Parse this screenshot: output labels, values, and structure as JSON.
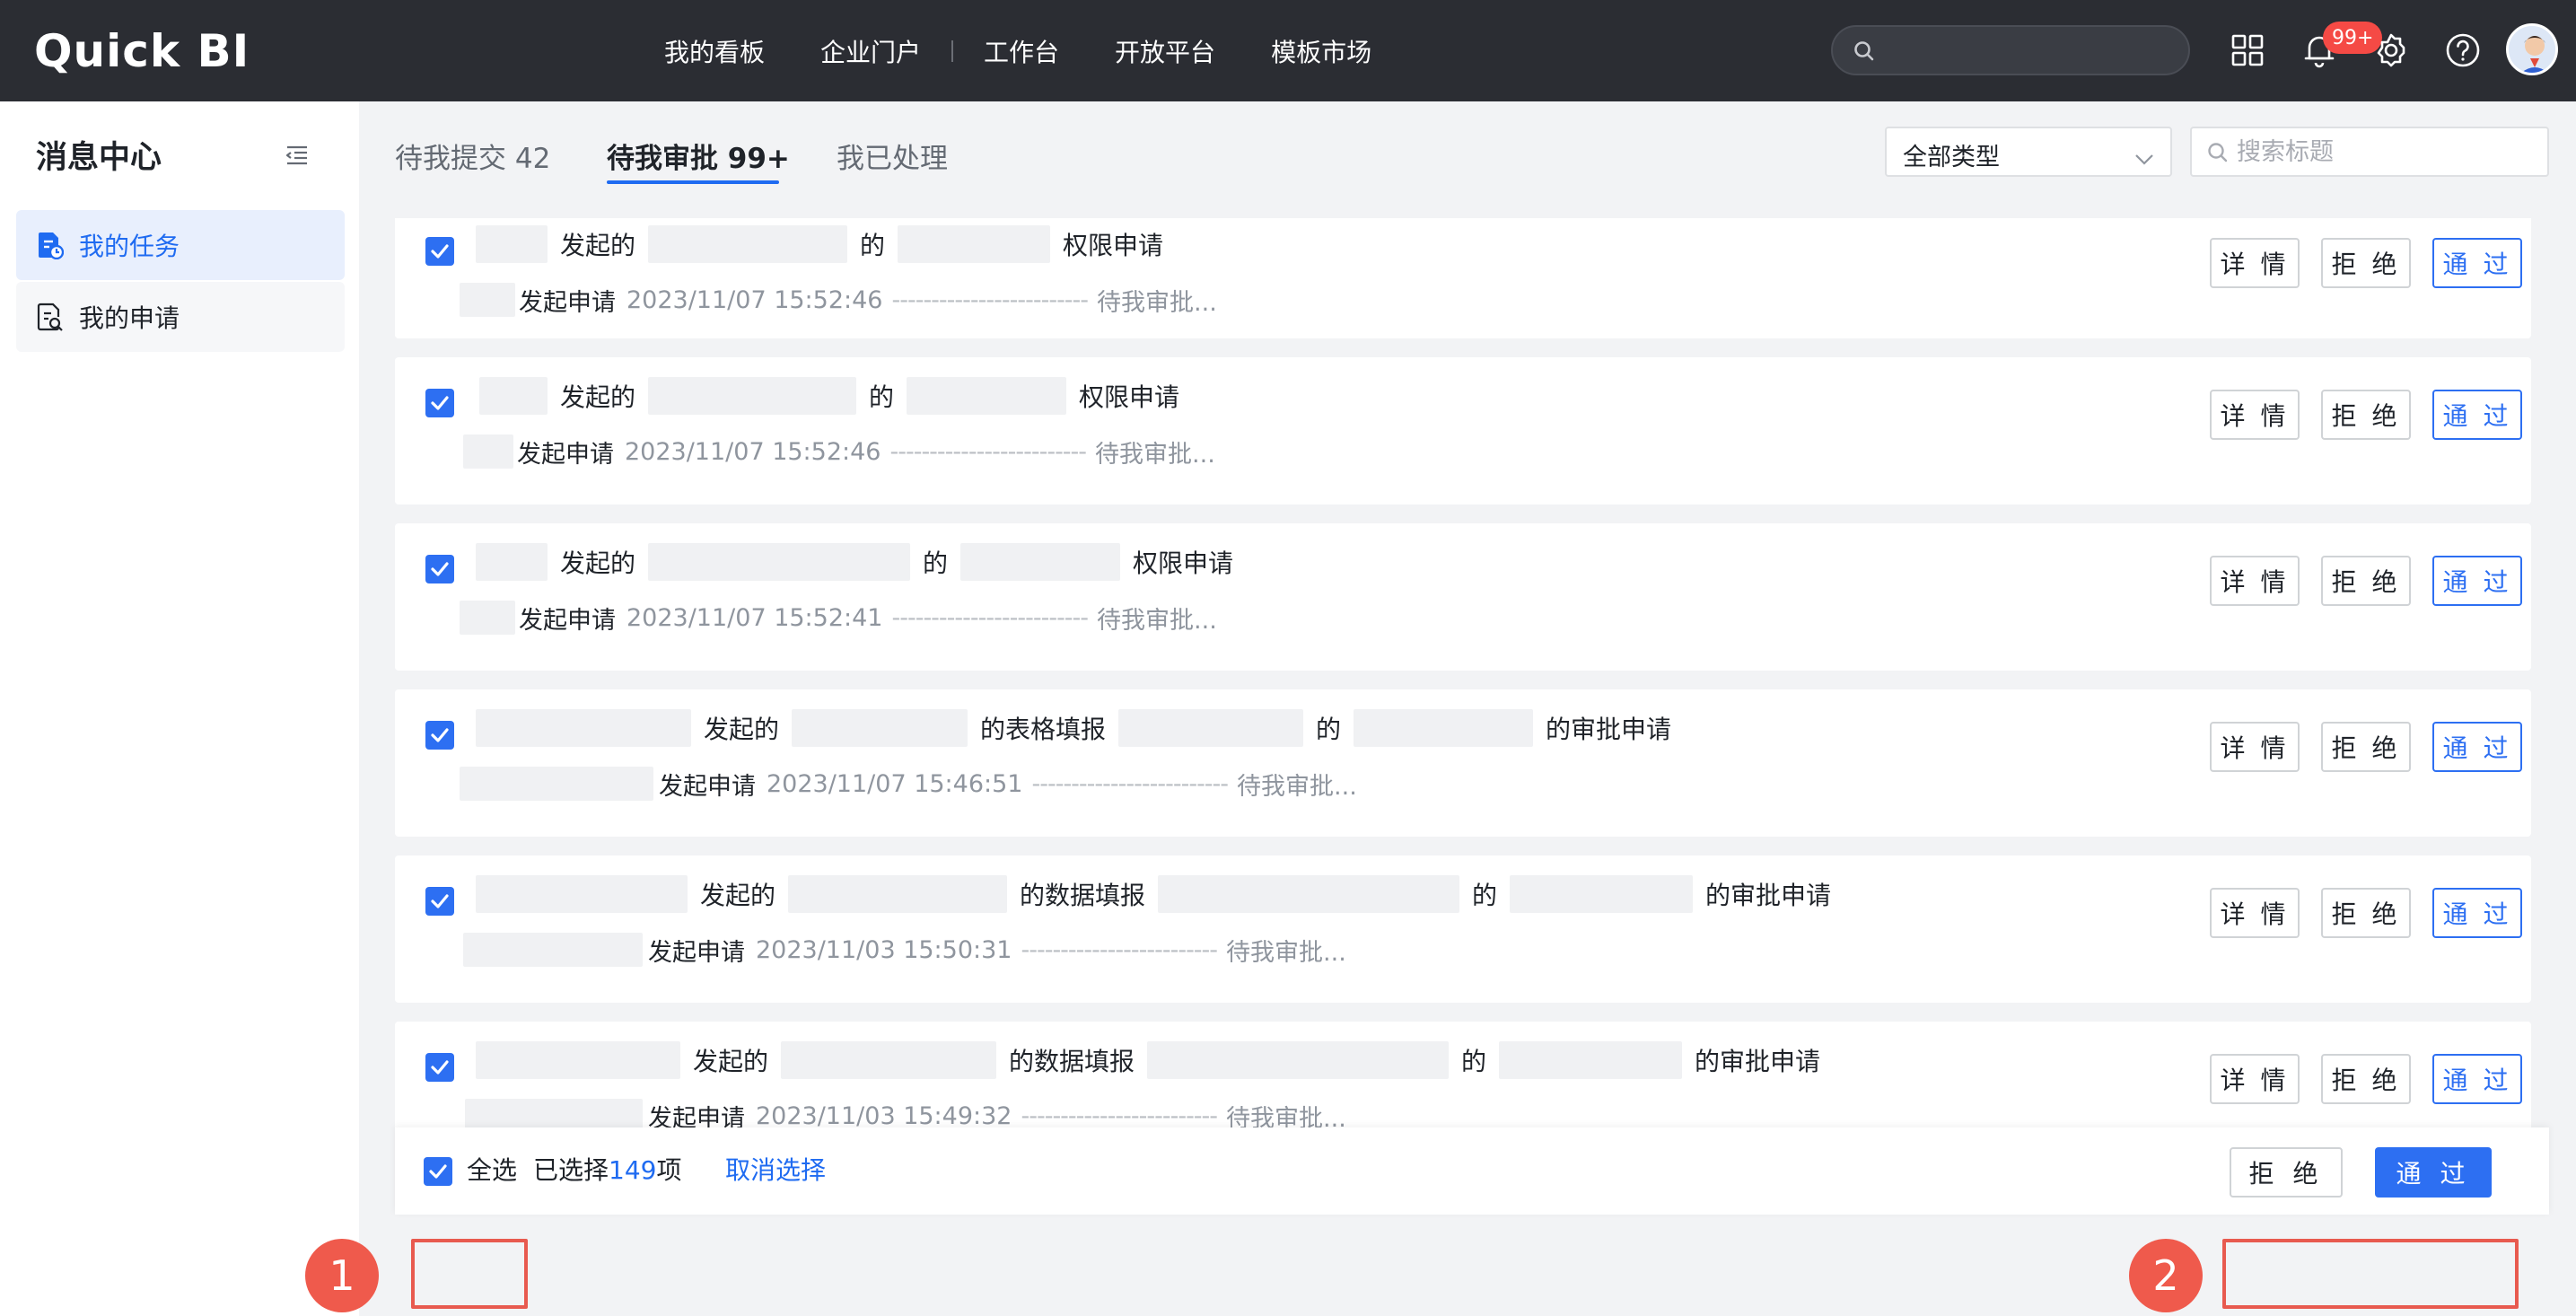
{
  "app": {
    "logo": "Quick BI",
    "nav": [
      "我的看板",
      "企业门户",
      "工作台",
      "开放平台",
      "模板市场"
    ],
    "notification_badge": "99+"
  },
  "sidebar": {
    "title": "消息中心",
    "items": [
      {
        "label": "我的任务",
        "active": true
      },
      {
        "label": "我的申请",
        "active": false
      }
    ]
  },
  "tabs": {
    "pending_submit": "待我提交 42",
    "pending_approve": "待我审批 99+",
    "processed": "我已处理"
  },
  "filters": {
    "type_select": "全部类型",
    "search_placeholder": "搜索标题"
  },
  "labels": {
    "initiated": "发起的",
    "of": "的",
    "permission_request": "权限申请",
    "form_fill": "的表格填报",
    "data_fill": "的数据填报",
    "approval_request": "的审批申请",
    "submit_request": "发起申请",
    "dashes": "-------------------------",
    "status": "待我审批...",
    "detail": "详 情",
    "reject": "拒 绝",
    "pass": "通 过"
  },
  "items": [
    {
      "time": "2023/11/07 15:52:46"
    },
    {
      "time": "2023/11/07 15:52:46"
    },
    {
      "time": "2023/11/07 15:52:41"
    },
    {
      "time": "2023/11/07 15:46:51"
    },
    {
      "time": "2023/11/03 15:50:31"
    },
    {
      "time": "2023/11/03 15:49:32"
    }
  ],
  "bottom": {
    "select_all": "全选",
    "selected_prefix": "已选择",
    "selected_count": "149",
    "selected_suffix": "项",
    "cancel_selection": "取消选择",
    "reject": "拒 绝",
    "pass": "通 过"
  },
  "markers": [
    "1",
    "2"
  ],
  "colors": {
    "topbar": "#2b2d33",
    "primary": "#2d6ff2",
    "marker": "#ef5a4c"
  }
}
